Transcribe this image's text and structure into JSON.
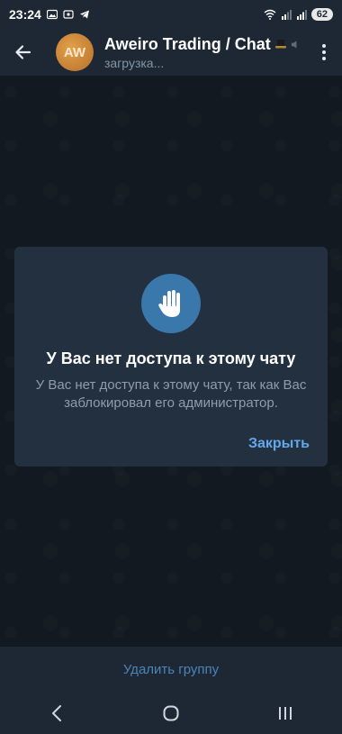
{
  "status_bar": {
    "time": "23:24",
    "battery": "62",
    "net_speed": ""
  },
  "header": {
    "avatar_initials": "AW",
    "title": "Aweiro Trading / Chat",
    "subtitle": "загрузка..."
  },
  "dialog": {
    "title": "У Вас нет доступа к этому чату",
    "message": "У Вас нет доступа к этому чату, так как Вас заблокировал его администратор.",
    "close_label": "Закрыть"
  },
  "bottom": {
    "delete_group_label": "Удалить группу"
  },
  "icons": {
    "back": "arrow-left-icon",
    "menu": "more-vert-icon",
    "hand": "hand-stop-icon",
    "nav_back": "nav-back-icon",
    "nav_home": "nav-home-icon",
    "nav_recents": "nav-recents-icon"
  },
  "colors": {
    "accent": "#62a8ea",
    "avatar": "#d08a3c",
    "hand_circle": "#3a77ab"
  }
}
